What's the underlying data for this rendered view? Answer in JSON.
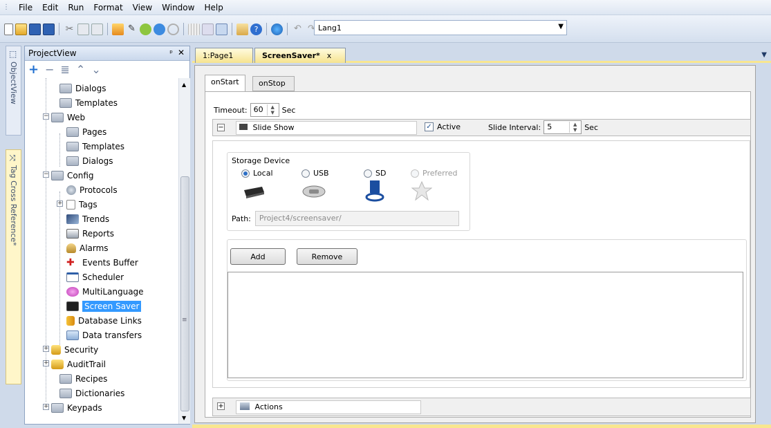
{
  "menubar": {
    "items": [
      "File",
      "Edit",
      "Run",
      "Format",
      "View",
      "Window",
      "Help"
    ]
  },
  "toolbar": {
    "language_value": "Lang1"
  },
  "side_strip": {
    "tabs": [
      "ObjectView",
      "Tag Cross Reference*"
    ]
  },
  "project_view": {
    "title": "ProjectView",
    "tree": [
      {
        "label": "Dialogs",
        "icon": "folder-icon"
      },
      {
        "label": "Templates",
        "icon": "folder-icon"
      },
      {
        "label": "Web",
        "icon": "folder-icon"
      },
      {
        "label": "Pages",
        "icon": "folder-icon"
      },
      {
        "label": "Templates",
        "icon": "folder-icon"
      },
      {
        "label": "Dialogs",
        "icon": "folder-icon"
      },
      {
        "label": "Config",
        "icon": "folder-icon"
      },
      {
        "label": "Protocols",
        "icon": "protocols-icon"
      },
      {
        "label": "Tags",
        "icon": "tags-icon"
      },
      {
        "label": "Trends",
        "icon": "trends-icon"
      },
      {
        "label": "Reports",
        "icon": "printer-icon"
      },
      {
        "label": "Alarms",
        "icon": "alarm-icon"
      },
      {
        "label": "Events Buffer",
        "icon": "events-pin-icon"
      },
      {
        "label": "Scheduler",
        "icon": "calendar-icon"
      },
      {
        "label": "MultiLanguage",
        "icon": "speech-bubble-icon"
      },
      {
        "label": "Screen Saver",
        "icon": "monitor-icon"
      },
      {
        "label": "Database Links",
        "icon": "database-icon"
      },
      {
        "label": "Data transfers",
        "icon": "data-transfer-icon"
      },
      {
        "label": "Security",
        "icon": "lock-icon"
      },
      {
        "label": "AuditTrail",
        "icon": "audit-icon"
      },
      {
        "label": "Recipes",
        "icon": "folder-icon"
      },
      {
        "label": "Dictionaries",
        "icon": "folder-icon"
      },
      {
        "label": "Keypads",
        "icon": "folder-icon"
      }
    ]
  },
  "document_tabs": [
    {
      "label": "1:Page1"
    },
    {
      "label": "ScreenSaver*",
      "close": "x"
    }
  ],
  "editor": {
    "inner_tabs": [
      "onStart",
      "onStop"
    ],
    "timeout_label": "Timeout:",
    "timeout_value": "60",
    "timeout_unit": "Sec",
    "slideshow_value": "Slide Show",
    "active_label": "Active",
    "slide_interval_label": "Slide Interval:",
    "slide_interval_value": "5",
    "slide_interval_unit": "Sec",
    "storage_title": "Storage Device",
    "storage_options": [
      "Local",
      "USB",
      "SD",
      "Preferred"
    ],
    "selected_storage": "Local",
    "path_label": "Path:",
    "path_value": "Project4/screensaver/",
    "add_button": "Add",
    "remove_button": "Remove",
    "actions_value": "Actions"
  }
}
